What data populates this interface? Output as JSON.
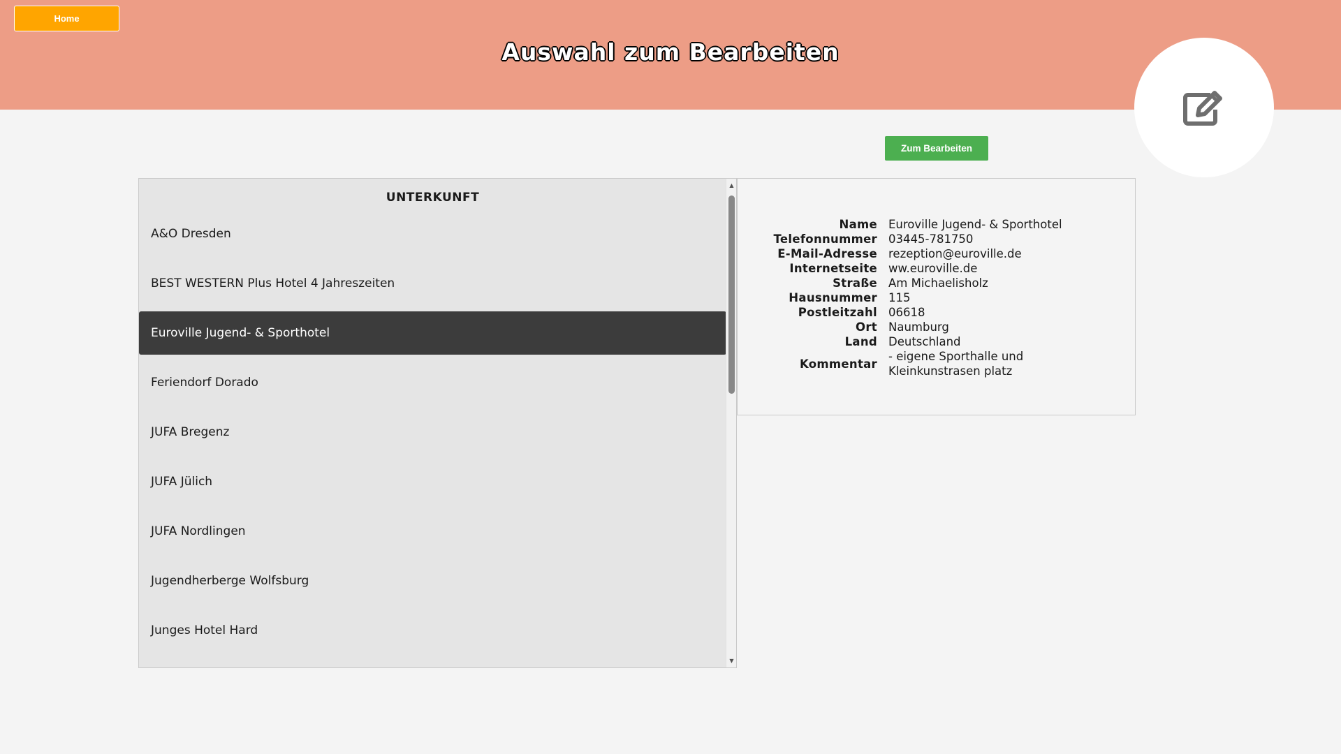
{
  "header": {
    "home_label": "Home",
    "title": "Auswahl zum Bearbeiten",
    "accent_color": "#ed9d86",
    "home_color": "#ffa500",
    "icon": "edit-icon"
  },
  "actions": {
    "edit_label": "Zum Bearbeiten",
    "edit_color": "#4caf50"
  },
  "list": {
    "header": "UNTERKUNFT",
    "selected_index": 2,
    "items": [
      "A&O Dresden",
      "BEST WESTERN Plus Hotel 4 Jahreszeiten",
      "Euroville Jugend- & Sporthotel",
      "Feriendorf Dorado",
      "JUFA Bregenz",
      "JUFA Jülich",
      "JUFA Nordlingen",
      "Jugendherberge Wolfsburg",
      "Junges Hotel Hard"
    ]
  },
  "details": {
    "rows": [
      {
        "key": "Name",
        "value": "Euroville Jugend- & Sporthotel"
      },
      {
        "key": "Telefonnummer",
        "value": "03445-781750"
      },
      {
        "key": "E-Mail-Adresse",
        "value": "rezeption@euroville.de"
      },
      {
        "key": "Internetseite",
        "value": "ww.euroville.de"
      },
      {
        "key": "Straße",
        "value": "Am Michaelisholz"
      },
      {
        "key": "Hausnummer",
        "value": "115"
      },
      {
        "key": "Postleitzahl",
        "value": "06618"
      },
      {
        "key": "Ort",
        "value": "Naumburg"
      },
      {
        "key": "Land",
        "value": "Deutschland"
      },
      {
        "key": "Kommentar",
        "value": "- eigene Sporthalle und Kleinkunstrasen platz"
      }
    ]
  }
}
